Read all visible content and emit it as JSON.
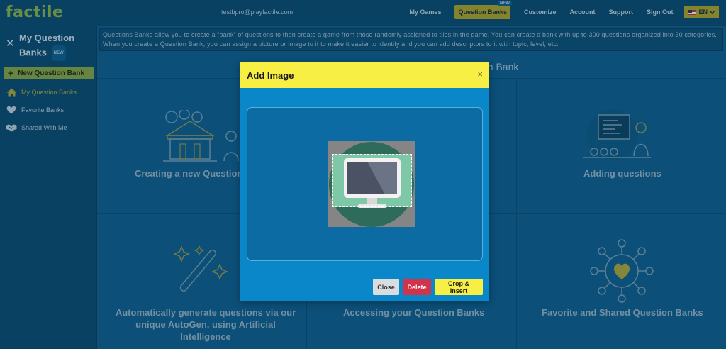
{
  "app": {
    "logo": "factile",
    "user_email": "testbpro@playfactile.com"
  },
  "nav": {
    "items": [
      {
        "label": "My Games"
      },
      {
        "label": "Question Banks",
        "badge": "NEW"
      },
      {
        "label": "Customize"
      },
      {
        "label": "Account"
      },
      {
        "label": "Support"
      },
      {
        "label": "Sign Out"
      }
    ],
    "language": "EN"
  },
  "sidebar": {
    "title": "My Question Banks",
    "title_badge": "NEW",
    "new_button": "New Question Bank",
    "items": [
      {
        "label": "My Question Banks",
        "icon": "home-icon"
      },
      {
        "label": "Favorite Banks",
        "icon": "heart-icon"
      },
      {
        "label": "Shared With Me",
        "icon": "handshake-icon"
      }
    ]
  },
  "main": {
    "info_text": "Questions Banks allow you to create a “bank” of questions to then create a game from those randomly assigned to tiles in the game. You can create a bank with up to 300 questions organized into 30 categories. When you create a Question Bank, you can assign a picture or image to it to make it easier to identify and you can add descriptors to it with topic, level, etc.",
    "heading_partial": "on Bank",
    "cards": [
      {
        "label": "Creating a new Question",
        "icon": "bank-building-icon"
      },
      {
        "label": "Adding questions",
        "icon": "presentation-board-icon"
      },
      {
        "label": "Automatically generate questions via our unique AutoGen, using Artificial Intelligence",
        "icon": "magic-wand-icon"
      },
      {
        "label": "Accessing your Question Banks",
        "icon": "folder-icon"
      },
      {
        "label": "Favorite and Shared Question Banks",
        "icon": "heart-network-icon"
      }
    ]
  },
  "modal": {
    "title": "Add Image",
    "close_symbol": "×",
    "buttons": {
      "close": "Close",
      "delete": "Delete",
      "crop_insert": "Crop & Insert"
    }
  },
  "colors": {
    "accent_yellow": "#f8ef44",
    "modal_blue": "#0a87c8",
    "delete_red": "#d3334a",
    "brand_green": "#8fb84a"
  }
}
